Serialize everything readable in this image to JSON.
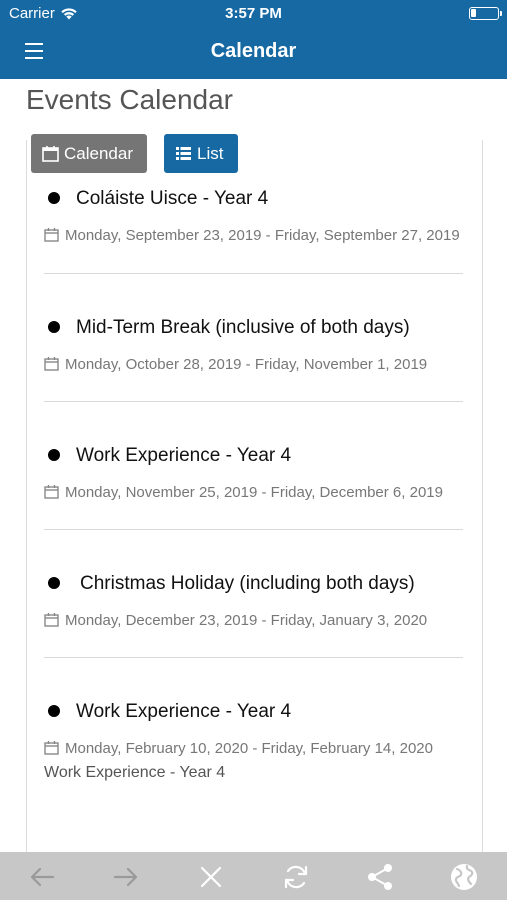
{
  "status_bar": {
    "carrier": "Carrier",
    "time": "3:57 PM",
    "battery_level": 0.2
  },
  "nav": {
    "title": "Calendar",
    "menu_icon": "hamburger-menu-icon"
  },
  "page": {
    "title": "Events Calendar"
  },
  "view_toggle": {
    "calendar_label": "Calendar",
    "list_label": "List",
    "active": "list"
  },
  "events": [
    {
      "title": "Coláiste Uisce - Year 4",
      "dates": "Monday, September 23, 2019 - Friday, September 27, 2019"
    },
    {
      "title": "Mid-Term Break (inclusive of both days)",
      "dates": "Monday, October 28, 2019 - Friday, November 1, 2019"
    },
    {
      "title": "Work Experience - Year 4",
      "dates": "Monday, November 25, 2019 - Friday, December 6, 2019"
    },
    {
      "title": "Christmas Holiday (including both days)",
      "dates": "Monday, December 23, 2019 - Friday, January 3, 2020"
    },
    {
      "title": "Work Experience - Year 4",
      "dates": "Monday, February 10, 2020 - Friday, February 14, 2020",
      "note": "Work Experience - Year 4"
    }
  ],
  "toolbar": [
    "back-arrow-icon",
    "forward-arrow-icon",
    "close-icon",
    "refresh-icon",
    "share-icon",
    "globe-icon"
  ],
  "colors": {
    "primary": "#1669a3",
    "secondary_button": "#757575",
    "toolbar": "#c7c7c7"
  }
}
